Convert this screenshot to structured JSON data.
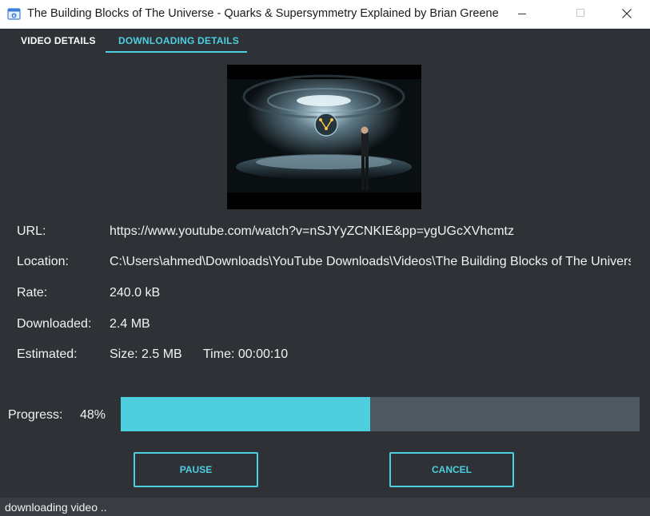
{
  "window": {
    "title": "The Building Blocks of The Universe - Quarks & Supersymmetry Explained by Brian Greene"
  },
  "tabs": [
    {
      "label": "VIDEO DETAILS",
      "active": false
    },
    {
      "label": "DOWNLOADING DETAILS",
      "active": true
    }
  ],
  "details": {
    "url_label": "URL:",
    "url_value": "https://www.youtube.com/watch?v=nSJYyZCNKIE&pp=ygUGcXVhcmtz",
    "location_label": "Location:",
    "location_value": "C:\\Users\\ahmed\\Downloads\\YouTube Downloads\\Videos\\The Building Blocks of The Universe - Quarks & Supersymmetry Explained by Brian Greene",
    "rate_label": "Rate:",
    "rate_value": "240.0 kB",
    "downloaded_label": "Downloaded:",
    "downloaded_value": "2.4 MB",
    "estimated_label": "Estimated:",
    "estimated_size": "Size: 2.5 MB",
    "estimated_time": "Time: 00:00:10"
  },
  "progress": {
    "label": "Progress:",
    "percent_text": "48%",
    "fraction": 0.48
  },
  "buttons": {
    "pause": "PAUSE",
    "cancel": "CANCEL"
  },
  "status": {
    "text": "downloading video .."
  },
  "colors": {
    "accent": "#4dcfe0",
    "background": "#2e3136",
    "track": "#4e5860"
  }
}
